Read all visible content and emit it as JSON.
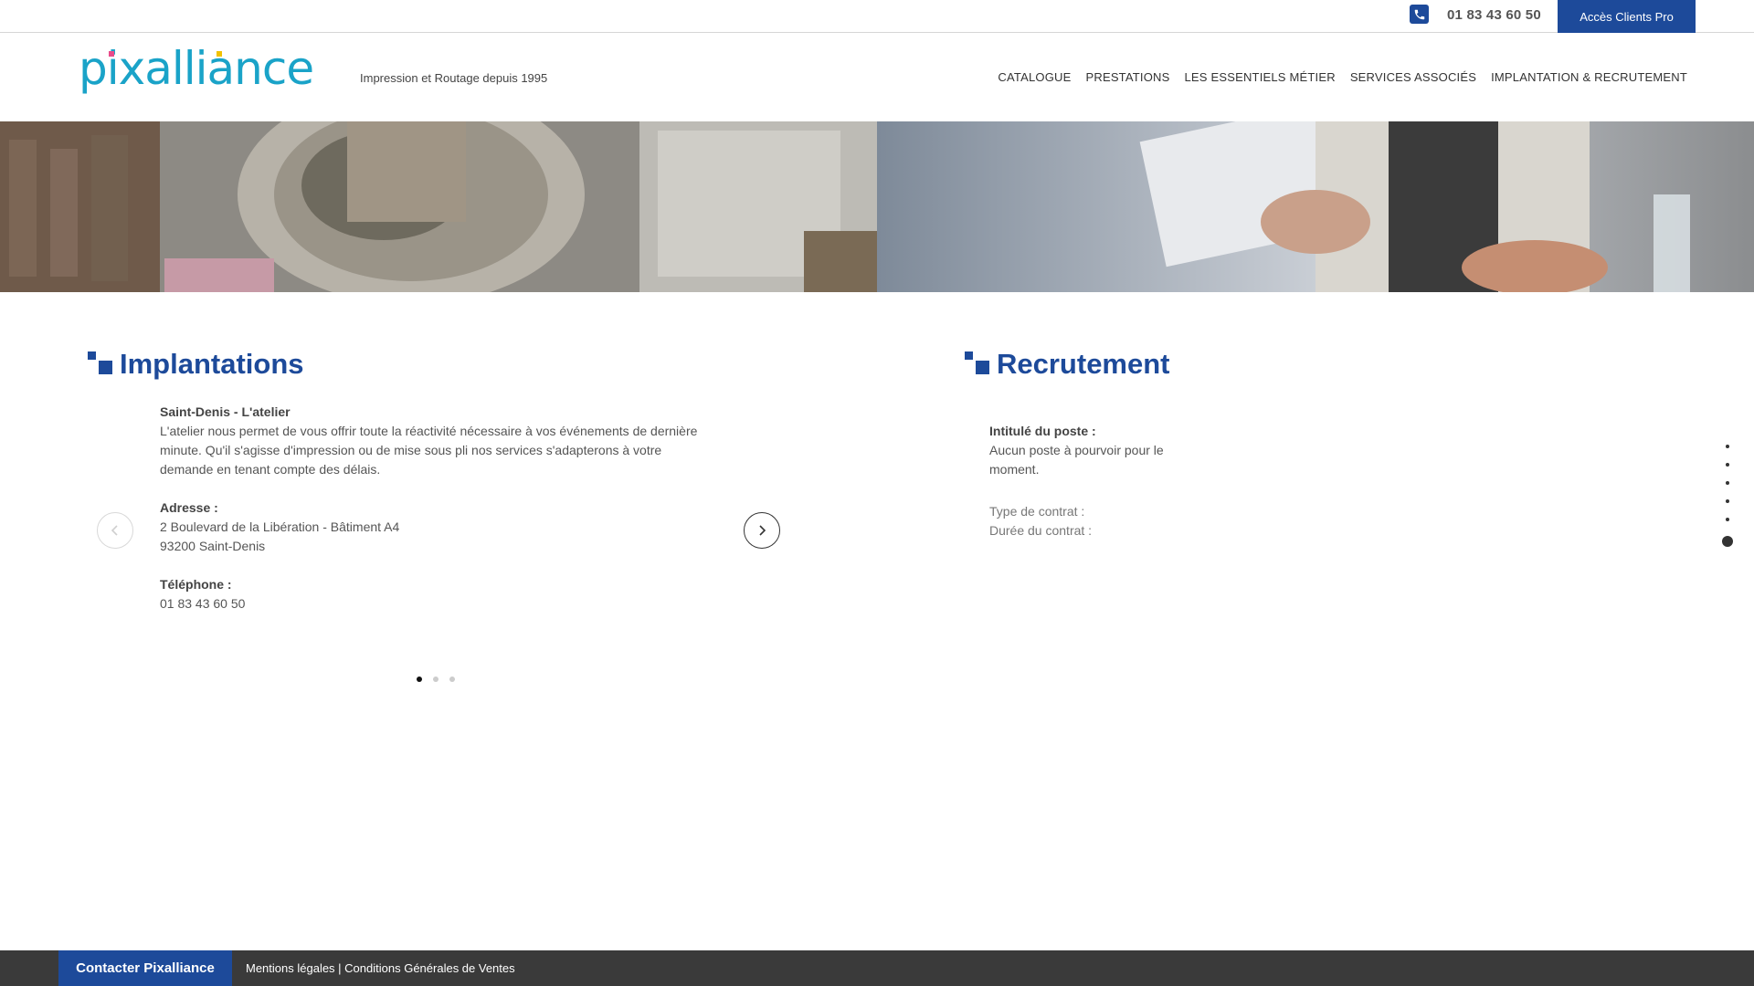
{
  "topbar": {
    "phone_icon": "phone-icon",
    "phone": "01 83 43 60 50",
    "pro_button": "Accès Clients Pro"
  },
  "header": {
    "logo_text": "pixalliance",
    "tagline": "Impression et Routage depuis 1995",
    "nav": [
      "CATALOGUE",
      "PRESTATIONS",
      "LES ESSENTIELS MÉTIER",
      "SERVICES ASSOCIÉS",
      "IMPLANTATION & RECRUTEMENT"
    ]
  },
  "implantations": {
    "title": "Implantations",
    "site_name": "Saint-Denis - L'atelier",
    "description": "L'atelier nous permet de vous offrir toute la réactivité nécessaire à vos événements de dernière minute. Qu'il s'agisse d'impression ou de mise sous pli nos services s'adapterons à votre demande en tenant compte des délais.",
    "address_label": "Adresse :",
    "address_line1": "2 Boulevard de la Libération - Bâtiment A4",
    "address_line2": "93200 Saint-Denis",
    "phone_label": "Téléphone :",
    "phone": "01 83 43 60 50",
    "slide_count": 3,
    "active_slide": 1
  },
  "recrutement": {
    "title": "Recrutement",
    "job_label": "Intitulé du poste :",
    "job_value": "Aucun poste à pourvoir pour le moment.",
    "contract_type_label": "Type de contrat :",
    "contract_duration_label": "Durée du contrat :"
  },
  "side_nav": {
    "count": 6,
    "active": 6
  },
  "footer": {
    "contact_button": "Contacter Pixalliance",
    "legal": "Mentions légales",
    "separator": " | ",
    "cgv": "Conditions Générales de Ventes"
  },
  "colors": {
    "brand": "#1d4a9a",
    "footer": "#3a3a3a",
    "logo_cyan": "#1aa3c8"
  }
}
